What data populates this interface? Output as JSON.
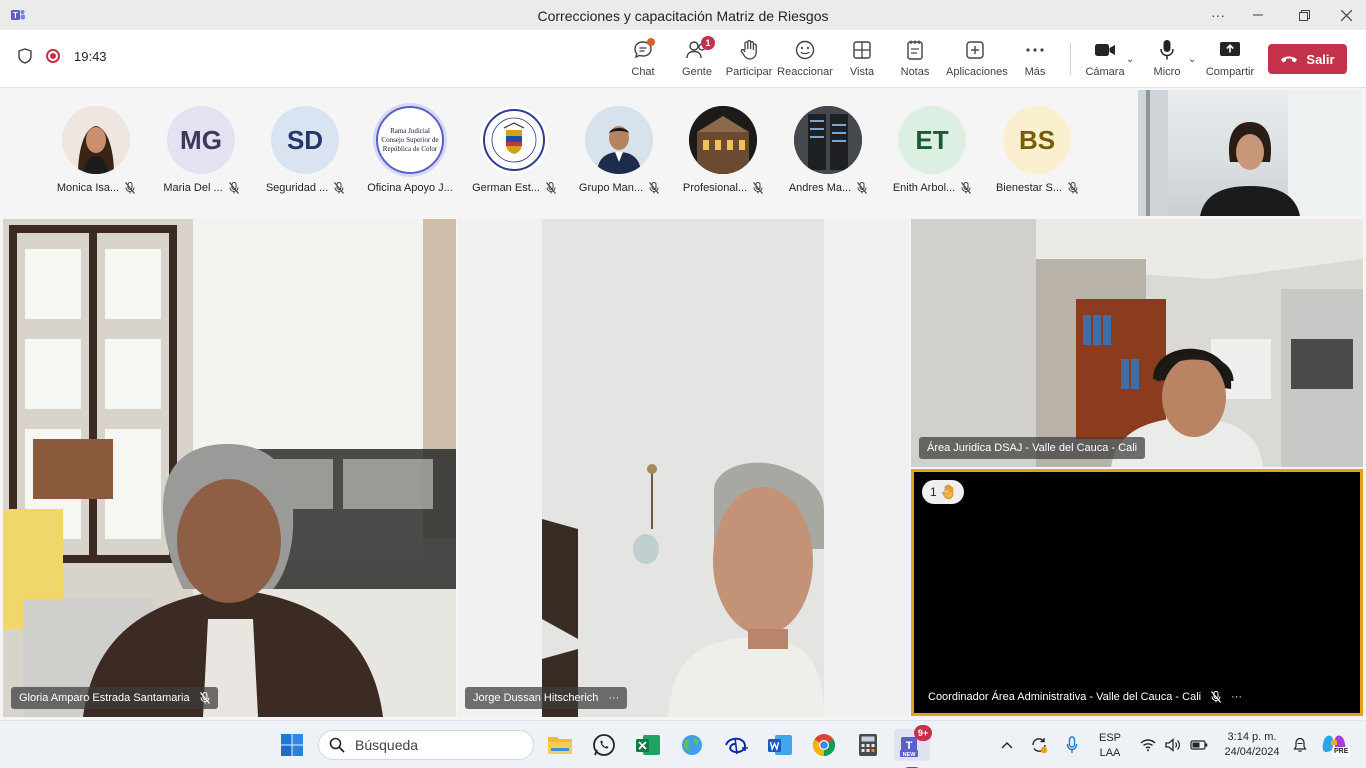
{
  "window": {
    "title": "Correcciones y capacitación Matriz de Riesgos",
    "more_label": "···"
  },
  "toolbar": {
    "time": "19:43",
    "chat": "Chat",
    "people": "Gente",
    "people_badge": "1",
    "raise": "Participar",
    "react": "Reaccionar",
    "view": "Vista",
    "notes": "Notas",
    "apps": "Aplicaciones",
    "more": "Más",
    "camera": "Cámara",
    "mic": "Micro",
    "share": "Compartir",
    "leave": "Salir"
  },
  "participants": [
    {
      "name": "Monica Isa...",
      "initials": "",
      "kind": "photo-woman"
    },
    {
      "name": "Maria Del ...",
      "initials": "MG",
      "kind": "initials",
      "bg": "#e6e1f2",
      "fg": "#3b3a5a"
    },
    {
      "name": "Seguridad ...",
      "initials": "SD",
      "kind": "initials",
      "bg": "#d9e3f2",
      "fg": "#1f3a66"
    },
    {
      "name": "Oficina Apoyo J...",
      "initials": "",
      "kind": "logo-rama",
      "logo_lines": [
        "Rama Judicial",
        "Consejo Superior de",
        "República de Color"
      ]
    },
    {
      "name": "German Est...",
      "initials": "",
      "kind": "logo-seal"
    },
    {
      "name": "Grupo Man...",
      "initials": "",
      "kind": "photo-man"
    },
    {
      "name": "Profesional...",
      "initials": "",
      "kind": "photo-building"
    },
    {
      "name": "Andres Ma...",
      "initials": "",
      "kind": "photo-server"
    },
    {
      "name": "Enith Arbol...",
      "initials": "ET",
      "kind": "initials",
      "bg": "#dcefe3",
      "fg": "#1d5a33"
    },
    {
      "name": "Bienestar S...",
      "initials": "BS",
      "kind": "initials",
      "bg": "#faf0cf",
      "fg": "#7a5b06"
    }
  ],
  "tiles": {
    "gloria": "Gloria Amparo Estrada Santamaria",
    "jorge": "Jorge Dussan Hitscherich",
    "area": "Área Juridica DSAJ - Valle del Cauca - Cali",
    "coord": "Coordinador Área Administrativa - Valle del Cauca - Cali",
    "hand_count": "1",
    "more": "···"
  },
  "taskbar": {
    "search_placeholder": "Búsqueda",
    "teams_badge": "9+",
    "teams_new": "NEW",
    "lang_top": "ESP",
    "lang_bottom": "LAA",
    "clock_time": "3:14 p. m.",
    "clock_date": "24/04/2024",
    "copilot_badge": "PRE"
  },
  "colors": {
    "leave": "#c4314b",
    "highlight": "#e3a21a",
    "teams": "#5b5fc7"
  }
}
